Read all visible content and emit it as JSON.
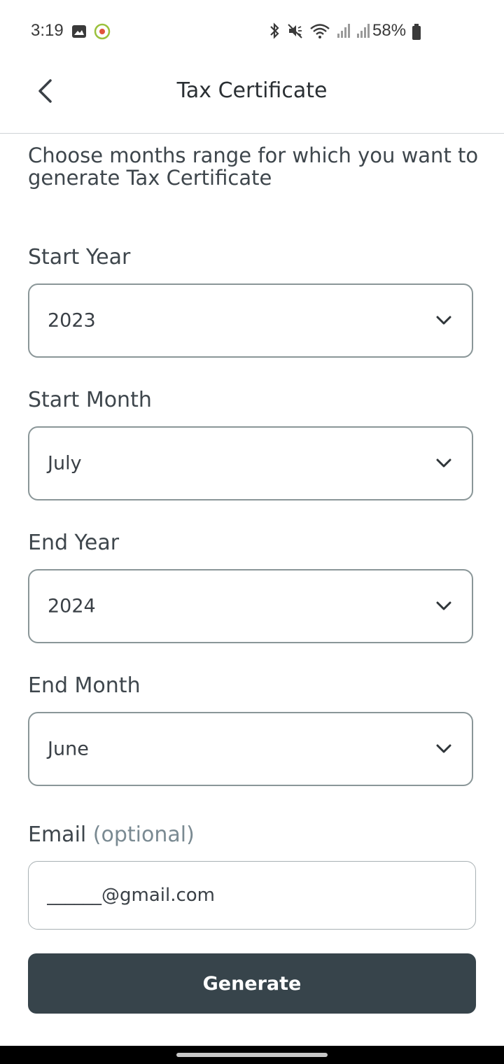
{
  "status_bar": {
    "time": "3:19",
    "battery_percent": "58%",
    "left_icons": [
      "image-icon",
      "target-icon"
    ],
    "right_icons": [
      "bluetooth-icon",
      "mute-icon",
      "wifi-icon",
      "signal-icon",
      "signal-icon",
      "battery-icon"
    ]
  },
  "app_bar": {
    "title": "Tax Certificate",
    "back_icon": "chevron-left-icon"
  },
  "form": {
    "intro": "Choose months range for which you want to generate Tax Certificate",
    "start_year": {
      "label": "Start Year",
      "value": "2023"
    },
    "start_month": {
      "label": "Start Month",
      "value": "July"
    },
    "end_year": {
      "label": "End Year",
      "value": "2024"
    },
    "end_month": {
      "label": "End Month",
      "value": "June"
    },
    "email": {
      "label": "Email",
      "optional": "(optional)",
      "value": "______@gmail.com"
    },
    "generate_label": "Generate"
  },
  "colors": {
    "button_bg": "#37444b",
    "border": "#8a9698",
    "text": "#3a4046"
  }
}
